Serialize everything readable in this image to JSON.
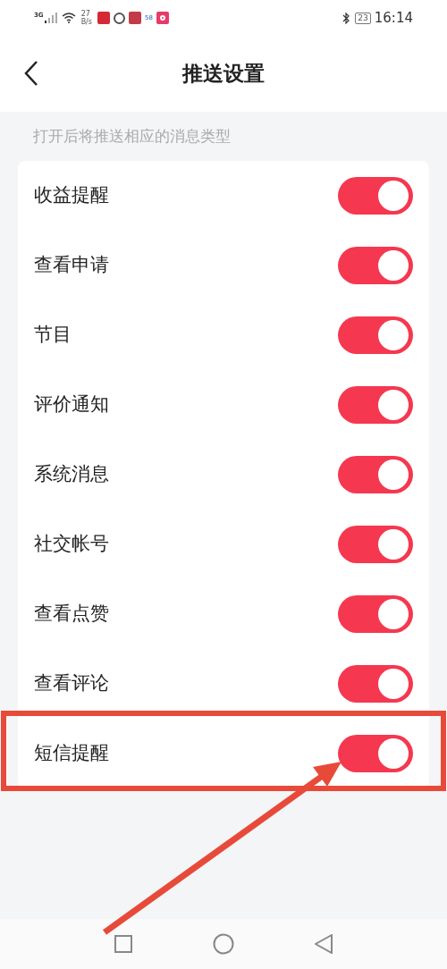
{
  "status_bar": {
    "network": "3G",
    "speed_value": "27",
    "speed_unit": "B/s",
    "app_badge": "58",
    "battery": "23",
    "time": "16:14"
  },
  "header": {
    "title": "推送设置"
  },
  "hint": "打开后将推送相应的消息类型",
  "settings": [
    {
      "label": "收益提醒",
      "on": true
    },
    {
      "label": "查看申请",
      "on": true
    },
    {
      "label": "节目",
      "on": true
    },
    {
      "label": "评价通知",
      "on": true
    },
    {
      "label": "系统消息",
      "on": true
    },
    {
      "label": "社交帐号",
      "on": true
    },
    {
      "label": "查看点赞",
      "on": true
    },
    {
      "label": "查看评论",
      "on": true
    },
    {
      "label": "短信提醒",
      "on": true
    }
  ]
}
